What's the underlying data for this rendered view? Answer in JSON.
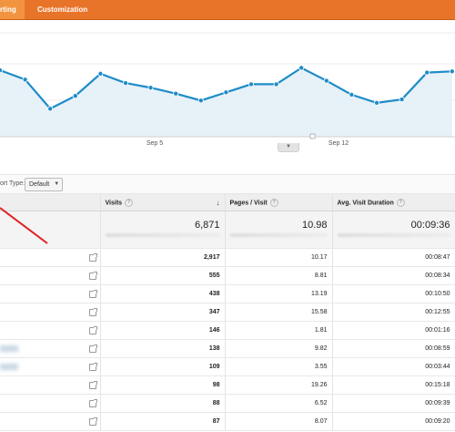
{
  "tabs": [
    {
      "label": "rting",
      "active": true
    },
    {
      "label": "Customization",
      "active": false
    }
  ],
  "chart_data": {
    "type": "area",
    "x_tick_labels": [
      "Sep 5",
      "Sep 12"
    ],
    "y_scale": "unlabeled (top of visible range = 1.0, relative line level)",
    "values": [
      0.57,
      0.49,
      0.24,
      0.35,
      0.54,
      0.46,
      0.42,
      0.37,
      0.31,
      0.38,
      0.45,
      0.45,
      0.59,
      0.48,
      0.36,
      0.29,
      0.32,
      0.55,
      0.56
    ],
    "line_color": "#1d8cc8",
    "fill_color": "#e7f1f8",
    "grid": true
  },
  "toolbar": {
    "report_type_label": "ort Type:",
    "report_type_value": "Default"
  },
  "table": {
    "headers": {
      "visits": "Visits",
      "pages_per_visit": "Pages / Visit",
      "avg_visit_duration": "Avg. Visit Duration"
    },
    "totals": {
      "visits": "6,871",
      "pages_per_visit": "10.98",
      "avg_visit_duration": "00:09:36"
    },
    "rows": [
      {
        "visits": "2,917",
        "pages": "10.17",
        "duration": "00:08:47",
        "blurred": false
      },
      {
        "visits": "555",
        "pages": "8.81",
        "duration": "00:08:34",
        "blurred": false
      },
      {
        "visits": "438",
        "pages": "13.19",
        "duration": "00:10:50",
        "blurred": false
      },
      {
        "visits": "347",
        "pages": "15.58",
        "duration": "00:12:55",
        "blurred": false
      },
      {
        "visits": "146",
        "pages": "1.81",
        "duration": "00:01:16",
        "blurred": false
      },
      {
        "visits": "138",
        "pages": "9.82",
        "duration": "00:08:59",
        "blurred": true
      },
      {
        "visits": "109",
        "pages": "3.55",
        "duration": "00:03:44",
        "blurred": true
      },
      {
        "visits": "98",
        "pages": "19.26",
        "duration": "00:15:18",
        "blurred": false
      },
      {
        "visits": "88",
        "pages": "6.52",
        "duration": "00:09:39",
        "blurred": false
      },
      {
        "visits": "87",
        "pages": "8.07",
        "duration": "00:09:20",
        "blurred": false
      }
    ]
  },
  "colors": {
    "tab_bar": "#e8742a",
    "tab_active": "#f2943f",
    "annotation_arrow": "#e02020"
  }
}
